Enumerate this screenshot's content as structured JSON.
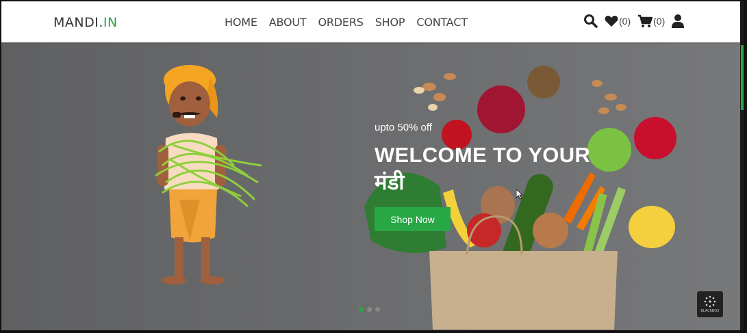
{
  "brand": {
    "name_main": "MANDI.",
    "name_accent": "IN"
  },
  "nav": {
    "home": "HOME",
    "about": "ABOUT",
    "orders": "ORDERS",
    "shop": "SHOP",
    "contact": "CONTACT"
  },
  "icons": {
    "search": "search-icon",
    "wishlist": "heart-icon",
    "cart": "cart-icon",
    "user": "user-icon"
  },
  "counters": {
    "wishlist": "(0)",
    "cart": "(0)"
  },
  "hero": {
    "subtitle": "upto 50% off",
    "title_line1": "WELCOME TO YOUR",
    "title_line2": "मंडी",
    "button_label": "Shop Now"
  },
  "badge": {
    "label": "BLACKBOX"
  },
  "colors": {
    "accent": "#28a745",
    "hero_bg": "#6a6b6d",
    "nav_text": "#444444"
  }
}
